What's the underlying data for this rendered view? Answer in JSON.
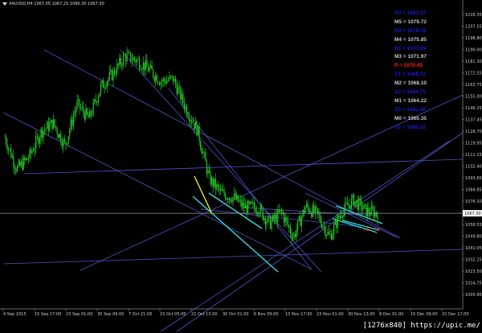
{
  "header": {
    "symbol_line": "XAUUSD,H4  1067.05  1067.25  1066.30  1067.00"
  },
  "watermark": "[1276x840] https://upic.me/",
  "colors": {
    "background": "#000000",
    "candles": "#22c922",
    "price_line": "#9a9a9a",
    "trendline_blue": "#4a57c8",
    "trendline_cyan": "#32dcdc",
    "trendline_yellow": "#f2ea1e",
    "pivot_mid": "#c8c8c8",
    "pivot_resistance": "#1a1ad8",
    "pivot_central": "#ff2020"
  },
  "pivots": [
    {
      "label": "R3",
      "value": "1081.37",
      "color": "#1a1ad8"
    },
    {
      "label": "M5",
      "value": "1079.72",
      "color": "#c8c8c8"
    },
    {
      "label": "R2",
      "value": "1078.16",
      "color": "#1a1ad8"
    },
    {
      "label": "M4",
      "value": "1075.85",
      "color": "#c8c8c8"
    },
    {
      "label": "R1",
      "value": "1073.59",
      "color": "#1a1ad8"
    },
    {
      "label": "M3",
      "value": "1071.97",
      "color": "#c8c8c8"
    },
    {
      "label": "P",
      "value": "1070.43",
      "color": "#ff2020"
    },
    {
      "label": "S1",
      "value": "1068.72",
      "color": "#1a1ad8"
    },
    {
      "label": "M2",
      "value": "1068.10",
      "color": "#c8c8c8"
    },
    {
      "label": "S2",
      "value": "1064.75",
      "color": "#1a1ad8"
    },
    {
      "label": "M1",
      "value": "1064.22",
      "color": "#c8c8c8"
    },
    {
      "label": "S3",
      "value": "1062.46",
      "color": "#1a1ad8"
    },
    {
      "label": "M0",
      "value": "1060.35",
      "color": "#c8c8c8"
    },
    {
      "label": "S3",
      "value": "1060.12",
      "color": "#1a1ad8"
    }
  ],
  "current_price_label": "1067.00",
  "chart_marker_label": "1063.50",
  "chart_data": {
    "type": "candlestick",
    "symbol": "XAUUSD",
    "timeframe": "H4",
    "ohlc": {
      "open": 1067.05,
      "high": 1067.25,
      "low": 1066.3,
      "close": 1067.0
    },
    "current_price": 1067.0,
    "ylim": [
      1001.25,
      1224.75
    ],
    "y_ticks": [
      "1216.35",
      "1207.55",
      "1198.80",
      "1190.00",
      "1181.30",
      "1172.55",
      "1163.75",
      "1155.00",
      "1146.25",
      "1137.45",
      "1128.70",
      "1119.95",
      "1111.15",
      "1102.40",
      "1093.65",
      "1084.85",
      "1076.10",
      "1067.00",
      "1058.55",
      "1049.80",
      "1041.05",
      "1032.25",
      "1023.50",
      "1014.75",
      "1005.95"
    ],
    "x_ticks": [
      "4 Sep 2015",
      "15 Sep 17:00",
      "23 Sep 01:00",
      "30 Sep 09:00",
      "7 Oct 21:00",
      "15 Oct 05:00",
      "22 Oct 13:00",
      "30 Oct 01:00",
      "6 Nov 09:00",
      "13 Nov 17:00",
      "23 Nov 01:00",
      "30 Nov 13:00",
      "8 Dec 01:00",
      "15 Dec 09:00",
      "22 Dec 17:00"
    ],
    "close_path": [
      [
        "4 Sep 2015",
        1124
      ],
      [
        "9 Sep",
        1100
      ],
      [
        "15 Sep 17:00",
        1109
      ],
      [
        "19 Sep",
        1128
      ],
      [
        "23 Sep 01:00",
        1135
      ],
      [
        "26 Sep",
        1118
      ],
      [
        "30 Sep 09:00",
        1149
      ],
      [
        "3 Oct",
        1138
      ],
      [
        "7 Oct 21:00",
        1162
      ],
      [
        "11 Oct",
        1172
      ],
      [
        "13 Oct",
        1185
      ],
      [
        "15 Oct 05:00",
        1182
      ],
      [
        "18 Oct",
        1175
      ],
      [
        "22 Oct 13:00",
        1166
      ],
      [
        "26 Oct",
        1168
      ],
      [
        "30 Oct 01:00",
        1147
      ],
      [
        "2 Nov",
        1130
      ],
      [
        "6 Nov 09:00",
        1093
      ],
      [
        "10 Nov",
        1082
      ],
      [
        "13 Nov 17:00",
        1079
      ],
      [
        "17 Nov",
        1071
      ],
      [
        "23 Nov 01:00",
        1072
      ],
      [
        "27 Nov",
        1059
      ],
      [
        "30 Nov 13:00",
        1068
      ],
      [
        "4 Dec",
        1049
      ],
      [
        "8 Dec 01:00",
        1072
      ],
      [
        "11 Dec",
        1066
      ],
      [
        "15 Dec 09:00",
        1049
      ],
      [
        "19 Dec",
        1068
      ],
      [
        "22 Dec 17:00",
        1077
      ],
      [
        "24 Dec",
        1069
      ],
      [
        "26 Dec",
        1067
      ]
    ]
  }
}
